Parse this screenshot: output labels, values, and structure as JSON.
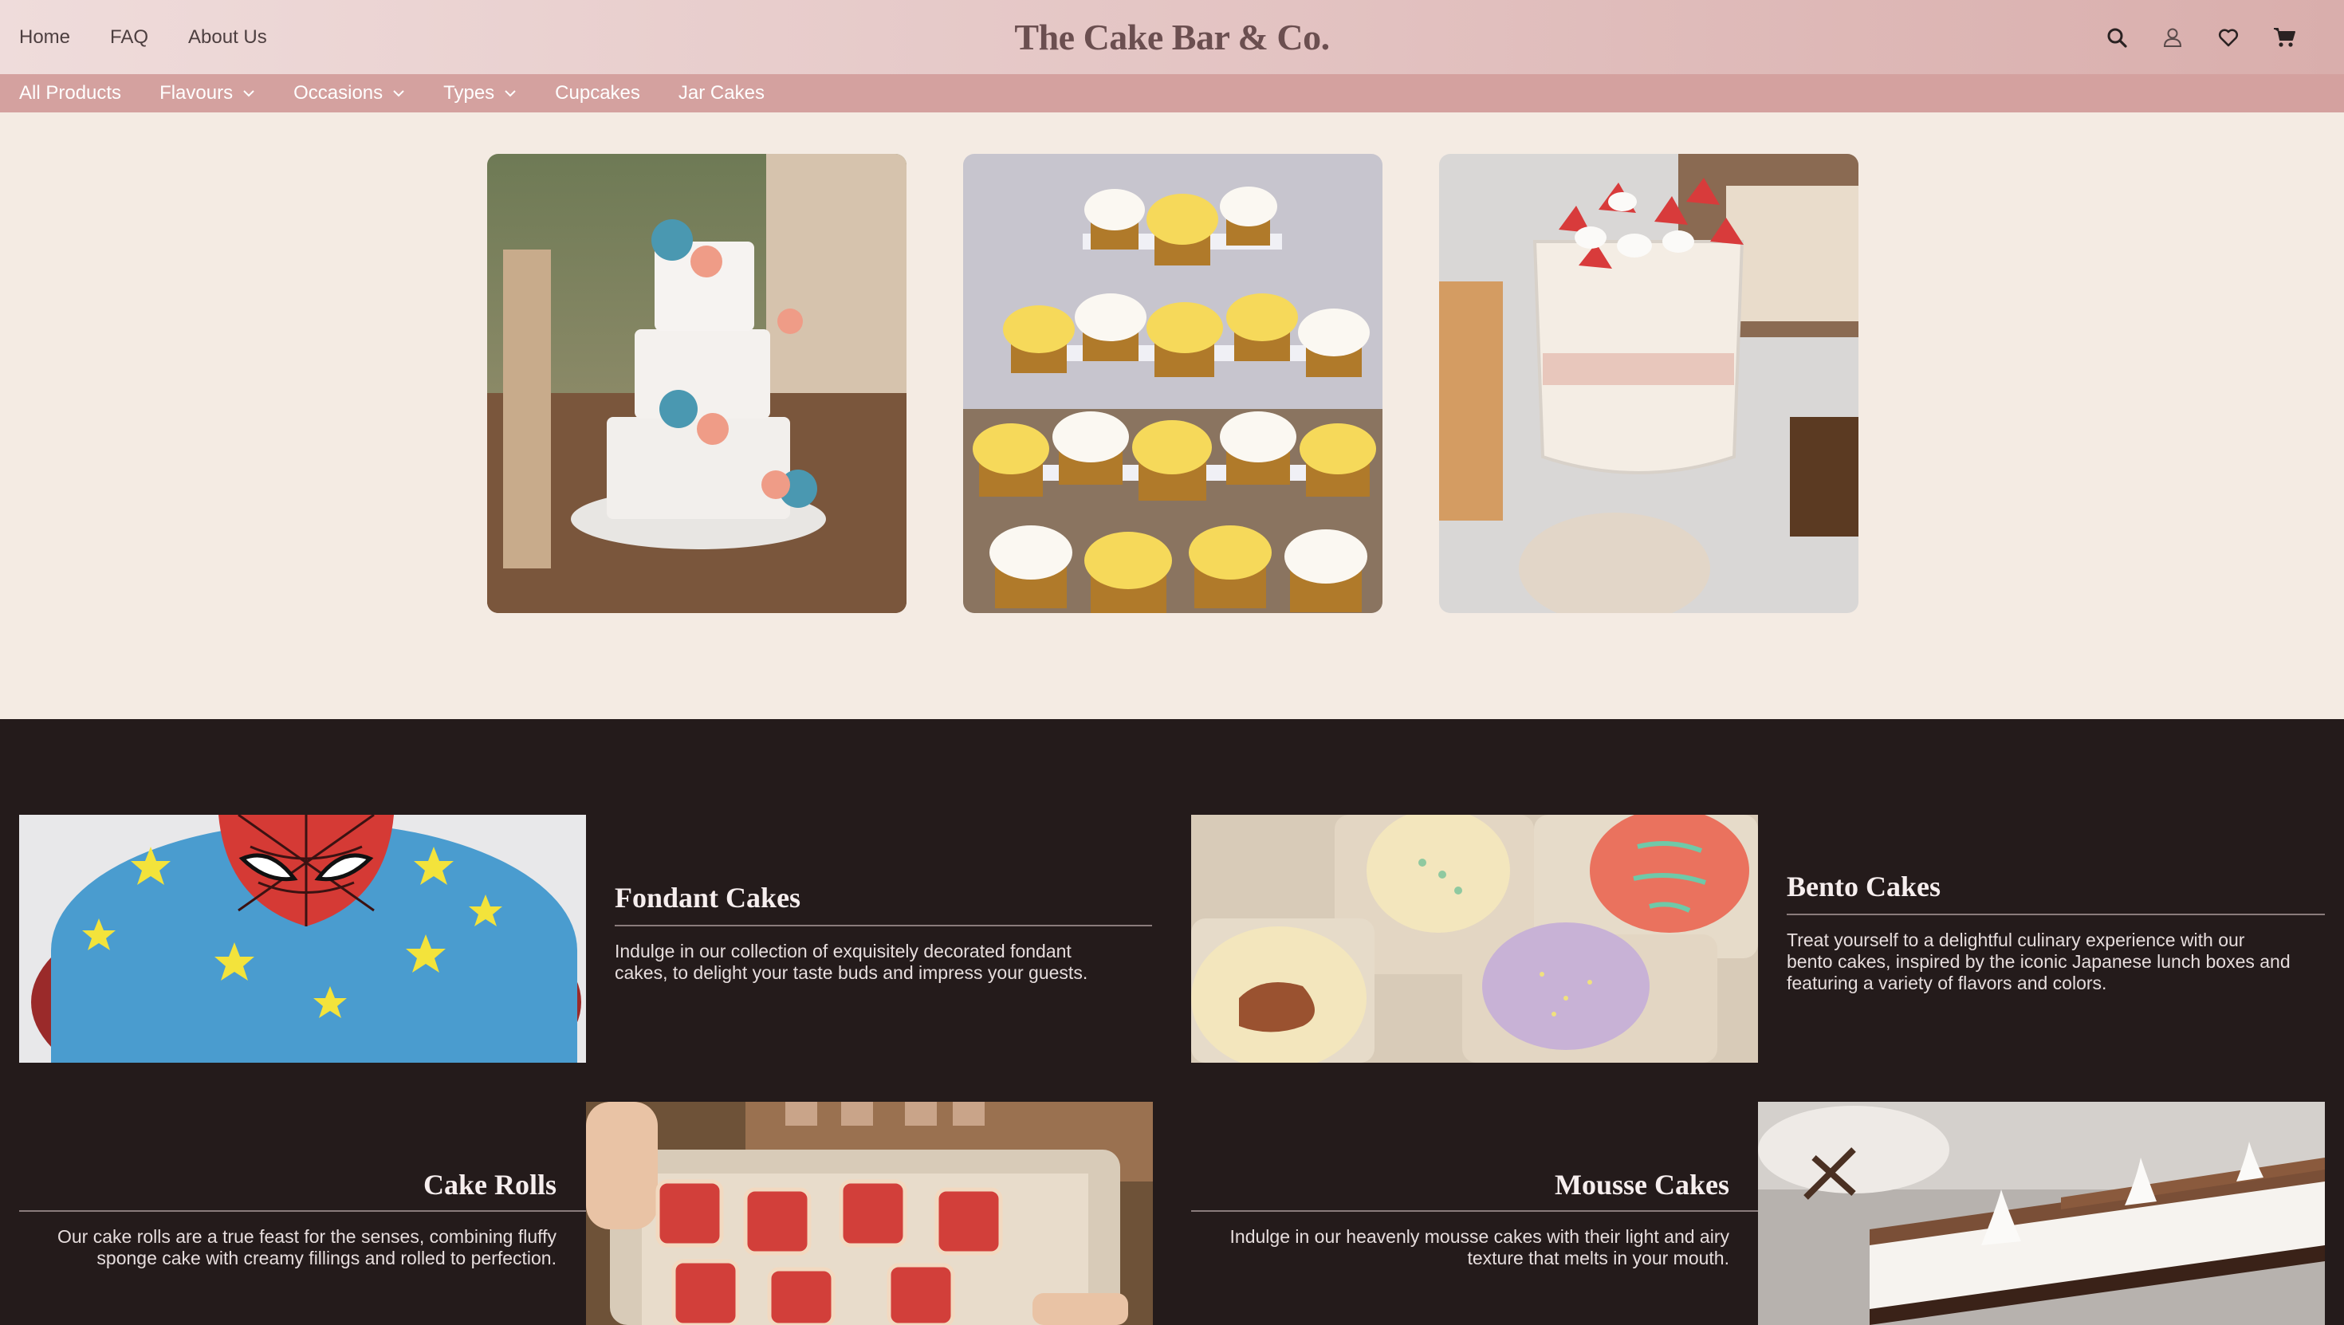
{
  "header": {
    "nav": [
      "Home",
      "FAQ",
      "About Us"
    ],
    "brand": "The Cake Bar & Co.",
    "tools": [
      "search-icon",
      "user-icon",
      "heart-icon",
      "cart-icon"
    ]
  },
  "categories": [
    {
      "label": "All Products",
      "dropdown": false
    },
    {
      "label": "Flavours",
      "dropdown": true
    },
    {
      "label": "Occasions",
      "dropdown": true
    },
    {
      "label": "Types",
      "dropdown": true
    },
    {
      "label": "Cupcakes",
      "dropdown": false
    },
    {
      "label": "Jar Cakes",
      "dropdown": false
    }
  ],
  "hero_images": [
    "tiered-wedding-cake-photo",
    "cupcake-tower-photo",
    "jar-cake-photo"
  ],
  "products": [
    {
      "title": "Fondant Cakes",
      "desc_lines": [
        "Indulge in our collection of exquisitely decorated fondant",
        "cakes, to delight your taste buds and impress your guests."
      ],
      "image": "spiderman-fondant-cake-photo"
    },
    {
      "title": "Bento Cakes",
      "desc_lines": [
        "Treat yourself to a delightful culinary experience with our",
        "bento cakes, inspired by the iconic Japanese lunch boxes and",
        "featuring a variety of flavors and colors."
      ],
      "image": "bento-cakes-photo"
    },
    {
      "title": "Cake Rolls",
      "desc_lines": [
        "Our cake rolls are a true feast for the senses, combining fluffy",
        "sponge cake with creamy fillings and rolled to perfection."
      ],
      "image": "cake-rolls-tray-photo"
    },
    {
      "title": "Mousse Cakes",
      "desc_lines": [
        "Indulge in our heavenly mousse cakes with their light and airy",
        "texture that melts in your mouth."
      ],
      "image": "mousse-cake-slices-photo"
    }
  ],
  "colors": {
    "page_bg": "#f4ebe3",
    "category_bar": "#d4a19f",
    "dark_section": "#241b1b",
    "brand_text": "#6b4f50"
  }
}
